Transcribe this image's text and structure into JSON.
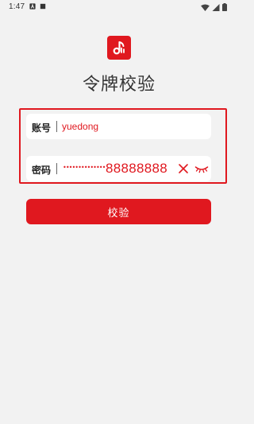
{
  "status_bar": {
    "time": "1:47"
  },
  "app": {
    "title": "令牌校验",
    "logo_icon": "music-note-icon",
    "accent_color": "#e0181f"
  },
  "form": {
    "account": {
      "label": "账号",
      "value": "yuedong"
    },
    "password": {
      "label": "密码",
      "masked": "••••••••••••••",
      "overlay_text": "88888888"
    }
  },
  "actions": {
    "verify_label": "校验"
  }
}
